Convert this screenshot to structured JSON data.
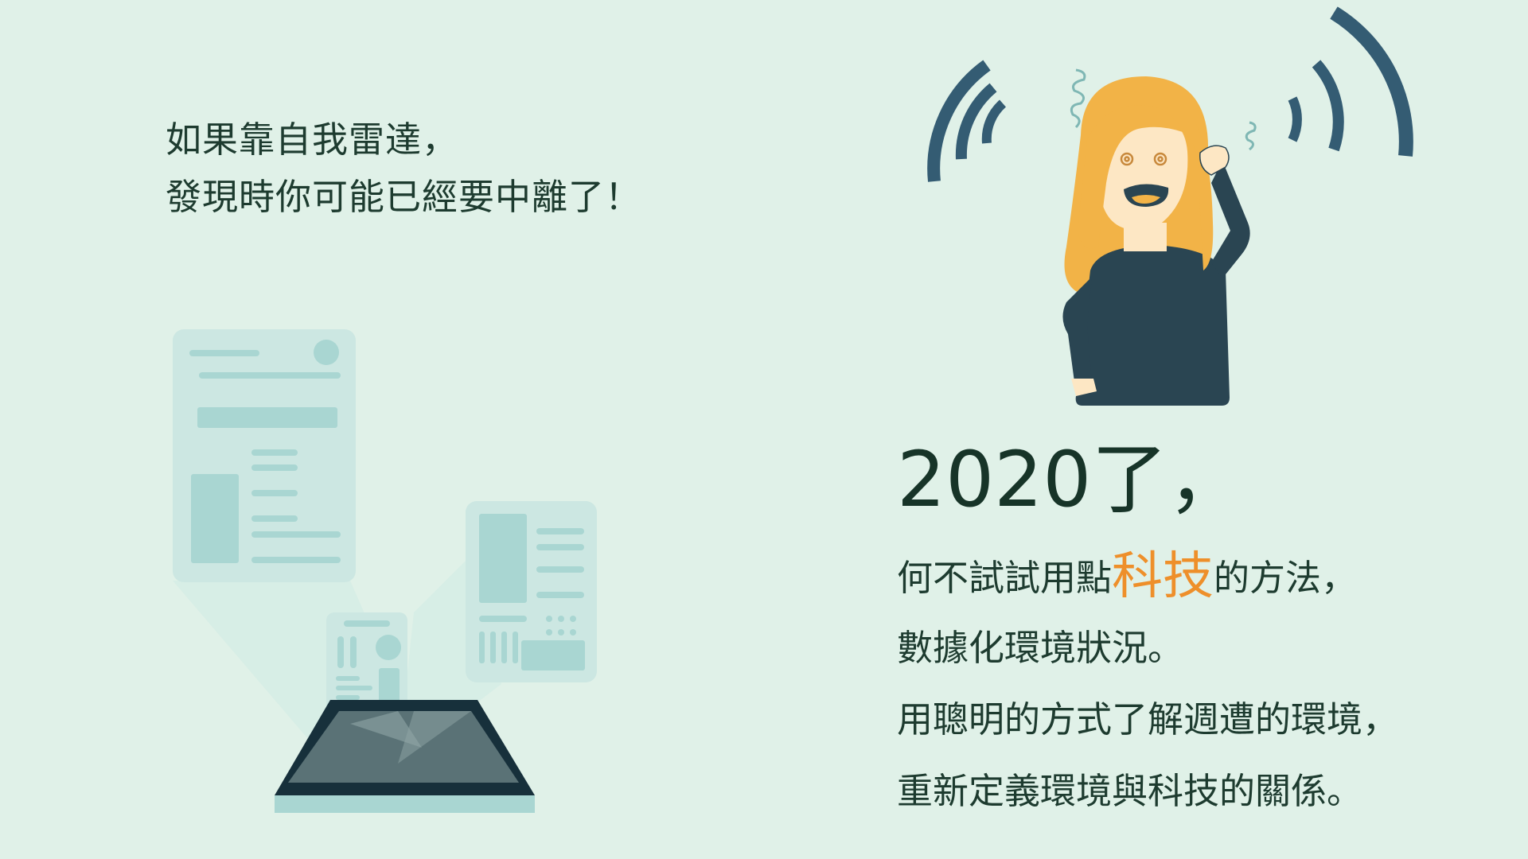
{
  "intro": {
    "line1": "如果靠自我雷達，",
    "line2": "發現時你可能已經要中離了！"
  },
  "headline": "2020了，",
  "body": {
    "line1_before": "何不試試用點",
    "line1_highlight": "科技",
    "line1_after": "的方法，",
    "line2": "數據化環境狀況。",
    "line3": "用聰明的方式了解週遭的環境，",
    "line4": "重新定義環境與科技的關係。"
  },
  "colors": {
    "background": "#e0f1e8",
    "text": "#1d3b2f",
    "highlight": "#ee8f2a",
    "signal": "#345c73",
    "hair": "#f2b347",
    "shirt": "#2a4552"
  },
  "icons": [
    "signal-waves-icon",
    "stressed-person-illustration",
    "phone-projecting-screens-illustration"
  ]
}
